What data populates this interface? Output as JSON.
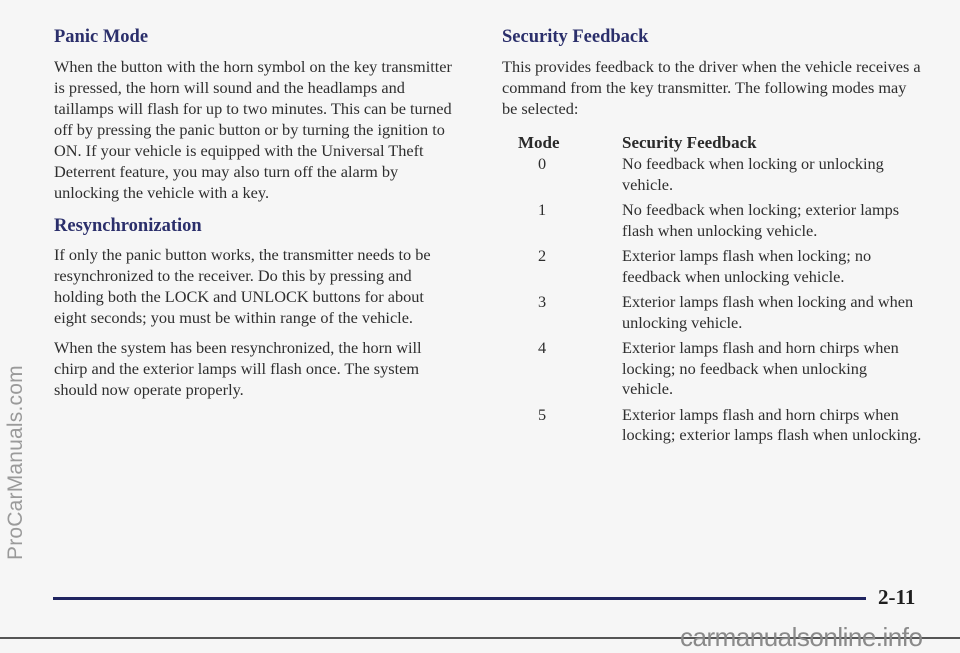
{
  "watermarks": {
    "side": "ProCarManuals.com",
    "bottom": "carmanualsonline.info"
  },
  "left": {
    "panic_mode": {
      "heading": "Panic Mode",
      "body": "When the button with the horn symbol on the key transmitter is pressed, the horn will sound and the headlamps and taillamps will flash for up to two minutes. This can be turned off by pressing the panic button or by turning the ignition to ON. If your vehicle is equipped with the Universal Theft Deterrent feature, you may also turn off the alarm by unlocking the vehicle with a key."
    },
    "resync": {
      "heading": "Resynchronization",
      "body1": "If only the panic button works, the transmitter needs to be resynchronized to the receiver. Do this by pressing and holding both the LOCK and UNLOCK buttons for about eight seconds; you must be within range of the vehicle.",
      "body2": "When the system has been resynchronized, the horn will chirp and the exterior lamps will flash once. The system should now operate properly."
    }
  },
  "right": {
    "heading": "Security Feedback",
    "intro": "This provides feedback to the driver when the vehicle receives a command from the key transmitter. The following modes may be selected:",
    "table": {
      "headers": [
        "Mode",
        "Security Feedback"
      ],
      "rows": [
        {
          "mode": "0",
          "desc": "No feedback when locking or unlocking vehicle."
        },
        {
          "mode": "1",
          "desc": "No feedback when locking; exterior lamps flash when unlocking vehicle."
        },
        {
          "mode": "2",
          "desc": "Exterior lamps flash when locking; no feedback when unlocking vehicle."
        },
        {
          "mode": "3",
          "desc": "Exterior lamps flash when locking and when unlocking vehicle."
        },
        {
          "mode": "4",
          "desc": "Exterior lamps flash and horn chirps when locking; no feedback when unlocking vehicle."
        },
        {
          "mode": "5",
          "desc": "Exterior lamps flash and horn chirps when locking; exterior lamps flash when unlocking."
        }
      ]
    }
  },
  "footer": {
    "page_number": "2-11"
  }
}
